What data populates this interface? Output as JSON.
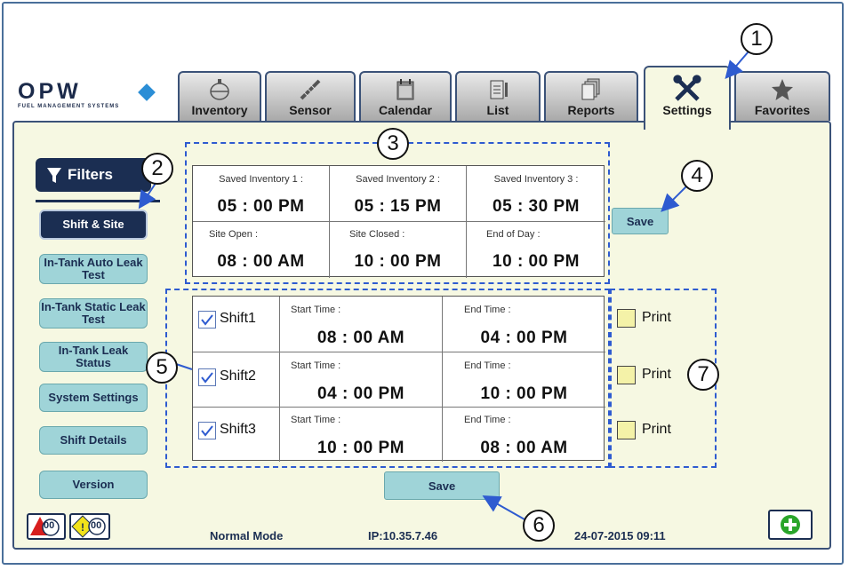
{
  "logo": {
    "word": "OPW",
    "subtitle": "FUEL MANAGEMENT SYSTEMS"
  },
  "tabs": [
    {
      "label": "Inventory",
      "icon": "tank-icon"
    },
    {
      "label": "Sensor",
      "icon": "probe-icon"
    },
    {
      "label": "Calendar",
      "icon": "calendar-icon"
    },
    {
      "label": "List",
      "icon": "list-icon"
    },
    {
      "label": "Reports",
      "icon": "reports-icon"
    },
    {
      "label": "Settings",
      "icon": "tools-icon",
      "active": true
    },
    {
      "label": "Favorites",
      "icon": "star-icon"
    }
  ],
  "filters": {
    "title": "Filters",
    "items": [
      "Shift & Site",
      "In-Tank Auto Leak Test",
      "In-Tank Static Leak Test",
      "In-Tank Leak Status",
      "System Settings",
      "Shift Details",
      "Version"
    ],
    "selected": "Shift & Site"
  },
  "times": {
    "saved1": {
      "label": "Saved Inventory 1 :",
      "value": "05 : 00 PM"
    },
    "saved2": {
      "label": "Saved Inventory 2 :",
      "value": "05 : 15 PM"
    },
    "saved3": {
      "label": "Saved Inventory 3 :",
      "value": "05 : 30 PM"
    },
    "site_open": {
      "label": "Site Open :",
      "value": "08 : 00 AM"
    },
    "site_closed": {
      "label": "Site Closed :",
      "value": "10 : 00 PM"
    },
    "end_of_day": {
      "label": "End of Day :",
      "value": "10 : 00 PM"
    }
  },
  "save_top": "Save",
  "shifts": [
    {
      "name": "Shift1",
      "checked": true,
      "start_label": "Start Time :",
      "start": "08 : 00 AM",
      "end_label": "End Time :",
      "end": "04 : 00 PM",
      "print": "Print"
    },
    {
      "name": "Shift2",
      "checked": true,
      "start_label": "Start Time :",
      "start": "04 : 00 PM",
      "end_label": "End Time :",
      "end": "10 : 00 PM",
      "print": "Print"
    },
    {
      "name": "Shift3",
      "checked": true,
      "start_label": "Start Time :",
      "start": "10 : 00 PM",
      "end_label": "End Time :",
      "end": "08 : 00 AM",
      "print": "Print"
    }
  ],
  "save_bottom": "Save",
  "status_bar": {
    "alarm_count": "00",
    "warning_count": "00",
    "mode": "Normal Mode",
    "ip": "IP:10.35.7.46",
    "datetime": "24-07-2015 09:11"
  },
  "callouts": [
    "1",
    "2",
    "3",
    "4",
    "5",
    "6",
    "7"
  ],
  "colors": {
    "navy": "#1b2e52",
    "teal_button": "#9fd4d8",
    "panel_bg": "#f6f8e2",
    "dash_blue": "#2e5bd0",
    "print_box": "#f4f2a8"
  }
}
